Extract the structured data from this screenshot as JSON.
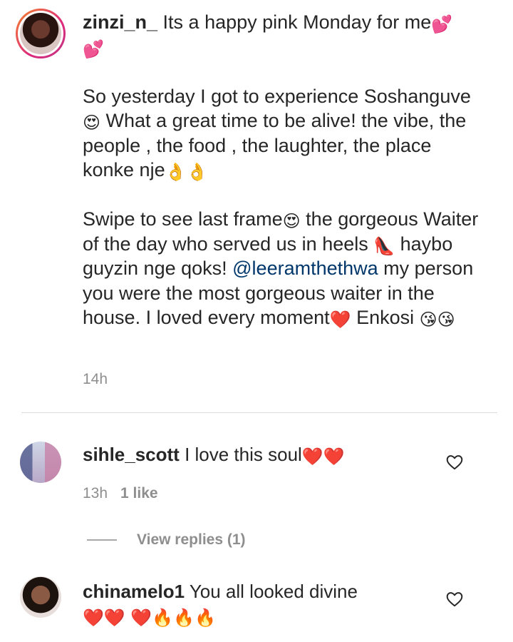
{
  "post": {
    "username": "zinzi_n_",
    "caption_line1": "Its a happy pink Monday for me",
    "caption_emoji1": "💕",
    "caption_emoji2": "💕",
    "paragraph1_a": "So yesterday I got to experience Soshanguve",
    "paragraph1_emoji": "😍",
    "paragraph1_b": " What a great time to be alive! the vibe, the people , the food , the laughter, the place konke nje",
    "paragraph1_emoji2": "👌👌",
    "paragraph2_a": "Swipe to see last frame",
    "paragraph2_emoji": "😍",
    "paragraph2_b": " the gorgeous Waiter of the day who served us in heels ",
    "paragraph2_emoji2": "👠",
    "paragraph2_c": " haybo guyzin nge qoks! ",
    "mention": "@leeramthethwa",
    "paragraph2_d": " my person you were the most gorgeous waiter in the house. I loved every moment",
    "paragraph2_emoji3": "❤️",
    "paragraph2_e": " Enkosi ",
    "paragraph2_emoji4": "😘😘",
    "time": "14h"
  },
  "comments": [
    {
      "username": "sihle_scott",
      "text": "I love this soul",
      "emoji": "❤️❤️",
      "time": "13h",
      "likes": "1 like",
      "view_replies": "View replies (1)"
    },
    {
      "username": "chinamelo1",
      "text": "You all looked divine ",
      "emoji": "❤️❤️ ❤️🔥🔥🔥"
    }
  ],
  "icons": {
    "like": "heart-outline-icon"
  },
  "colors": {
    "text": "#262626",
    "muted": "#8e8e8e",
    "mention": "#00376b",
    "heart": "#ed1c24"
  }
}
